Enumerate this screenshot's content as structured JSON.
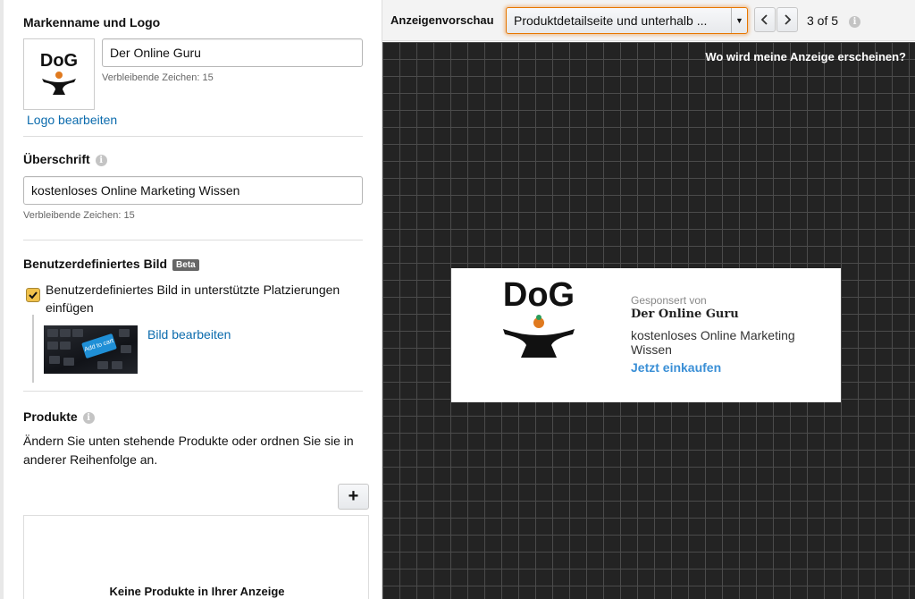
{
  "brand": {
    "section_title": "Markenname und Logo",
    "name_value": "Der Online Guru",
    "remaining": "Verbleibende Zeichen: 15",
    "edit_logo": "Logo bearbeiten",
    "logo_text": "DoG"
  },
  "headline": {
    "section_title": "Überschrift",
    "value": "kostenloses Online Marketing Wissen",
    "remaining": "Verbleibende Zeichen: 15"
  },
  "custom_image": {
    "section_title": "Benutzerdefiniertes Bild",
    "badge": "Beta",
    "checkbox_label": "Benutzerdefiniertes Bild in unterstützte Platzierungen einfügen",
    "edit_image": "Bild bearbeiten",
    "thumb_text": "Add to cart"
  },
  "products": {
    "section_title": "Produkte",
    "description": "Ändern Sie unten stehende Produkte oder ordnen Sie sie in anderer Reihenfolge an.",
    "add_button": "+",
    "empty_text": "Keine Produkte in Ihrer Anzeige"
  },
  "preview": {
    "label": "Anzeigenvorschau",
    "placement_selected": "Produktdetailseite und unterhalb ...",
    "page_counter": "3 of 5",
    "where_link": "Wo wird meine Anzeige erscheinen?",
    "prev_icon": "chevron-left-icon",
    "next_icon": "chevron-right-icon",
    "ad": {
      "sponsored": "Gesponsert von",
      "brand_name": "Der Online Guru",
      "headline": "kostenloses Online Marketing Wissen",
      "cta": "Jetzt einkaufen"
    }
  },
  "colors": {
    "accent_link": "#0b6bad",
    "focus_orange": "#e77600",
    "checkbox_fill": "#f0c14b",
    "canvas_bg": "#232323",
    "cta_blue": "#3a8fd6"
  }
}
